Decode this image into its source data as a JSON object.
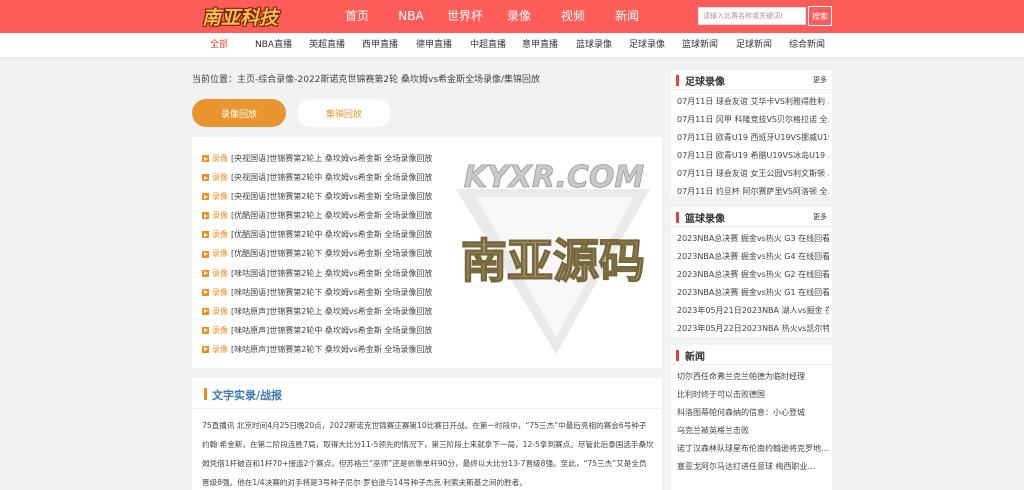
{
  "logo": {
    "text": "南亚科技"
  },
  "main_nav": [
    "首页",
    "NBA",
    "世界杯",
    "录像",
    "视频",
    "新闻"
  ],
  "search": {
    "placeholder": "请输入比赛名称或关键词!",
    "button_label": "搜索"
  },
  "sub_nav": [
    "全部",
    "NBA直播",
    "英超直播",
    "西甲直播",
    "德甲直播",
    "中超直播",
    "意甲直播",
    "篮球录像",
    "足球录像",
    "篮球新闻",
    "足球新闻",
    "综合新闻"
  ],
  "breadcrumb": "当前位置：主页-综合录像-2022斯诺克世锦赛第2轮 桑坎姆vs希金斯全场录像/集锦回放",
  "tabs": {
    "active": "录像回放",
    "inactive": "集锦回放"
  },
  "video_list": [
    {
      "tag": "录像",
      "title": "[央视国语]世锦赛第2轮上 桑坎姆vs希金斯 全场录像回放"
    },
    {
      "tag": "录像",
      "title": "[央视国语]世锦赛第2轮中 桑坎姆vs希金斯 全场录像回放"
    },
    {
      "tag": "录像",
      "title": "[央视国语]世锦赛第2轮下 桑坎姆vs希金斯 全场录像回放"
    },
    {
      "tag": "录像",
      "title": "[优酷国语]世锦赛第2轮上 桑坎姆vs希金斯 全场录像回放"
    },
    {
      "tag": "录像",
      "title": "[优酷国语]世锦赛第2轮中 桑坎姆vs希金斯 全场录像回放"
    },
    {
      "tag": "录像",
      "title": "[优酷国语]世锦赛第2轮下 桑坎姆vs希金斯 全场录像回放"
    },
    {
      "tag": "录像",
      "title": "[咪咕国语]世锦赛第2轮上 桑坎姆vs希金斯 全场录像回放"
    },
    {
      "tag": "录像",
      "title": "[咪咕国语]世锦赛第2轮下 桑坎姆vs希金斯 全场录像回放"
    },
    {
      "tag": "录像",
      "title": "[咪咕原声]世锦赛第2轮上 桑坎姆vs希金斯 全场录像回放"
    },
    {
      "tag": "录像",
      "title": "[咪咕原声]世锦赛第2轮中 桑坎姆vs希金斯 全场录像回放"
    },
    {
      "tag": "录像",
      "title": "[咪咕原声]世锦赛第2轮下 桑坎姆vs希金斯 全场录像回放"
    }
  ],
  "watermark": {
    "line1": "KYXR.COM",
    "line2": "南亚源码"
  },
  "text_section": {
    "title": "文字实录/战报",
    "article": "75直播讯 北京时间4月25日晚20点，2022斯诺克世锦赛正赛第10比赛日开战。在第一时段中，“75三杰”中最后亮相的赛会6号种子约翰·希金斯，在第二阶段连胜7局，取得大比分11-5领先的情况下，第三阶段上来就拿下一局，12-5拿到赛点。尽管此后泰国选手桑坎姆凭借1杆破百和1杆70+接连2个赛点，但苏格兰“巫师”还是依靠单杆90分，最终以大比分13-7晋级8强。至此，“75三杰”又是全员晋级8强。他在1/4决赛的对手将是3号种子尼尔·罗伯逊与14号种子杰克·利索夫斯基之间的胜者。"
  },
  "sidebar": {
    "more_label": "更多",
    "football": {
      "title": "足球录像",
      "items": [
        "07月11日 球会友谊 艾华卡VS利雅得胜利 …",
        "07月11日 冈甲 科隆竞技VS贝尔格拉诺 全…",
        "07月11日 欧青U19 西班牙U19VS挪威U19…",
        "07月11日 欧青U19 希腊U19VS冰岛U19 …",
        "07月11日 球会友谊 女王公园VS利文斯顿 …",
        "07月11日 约旦杯 阿尔赛萨里VS阿洛顿 全…"
      ]
    },
    "basketball": {
      "title": "篮球录像",
      "items": [
        "2023NBA总决赛 掘金vs热火 G3 在线回看…",
        "2023NBA总决赛 掘金vs热火 G4 在线回看…",
        "2023NBA总决赛 掘金vs热火 G2 在线回看…",
        "2023NBA总决赛 掘金vs热火 G1 在线回看…",
        "2023年05月21日2023NBA 湖人vs掘金 在…",
        "2023年05月22日2023NBA 热火vs凯尔特…"
      ]
    },
    "news": {
      "title": "新闻",
      "items": [
        "切尔西任命弗兰克兰帕德为临时经理",
        "比利时终于可以击败德国",
        "科洛图蒂帕何森纳的信息：小心登城",
        "乌克兰被英格兰击败",
        "诺丁汉森林队球星布伦南约翰逊将克罗地…",
        "塞亚戈阿尔马达打进任意球 梅西职业…"
      ]
    }
  },
  "colors": {
    "brand_red": "#fd5c59",
    "accent_orange": "#e8952f",
    "link_blue": "#3a78b0"
  }
}
